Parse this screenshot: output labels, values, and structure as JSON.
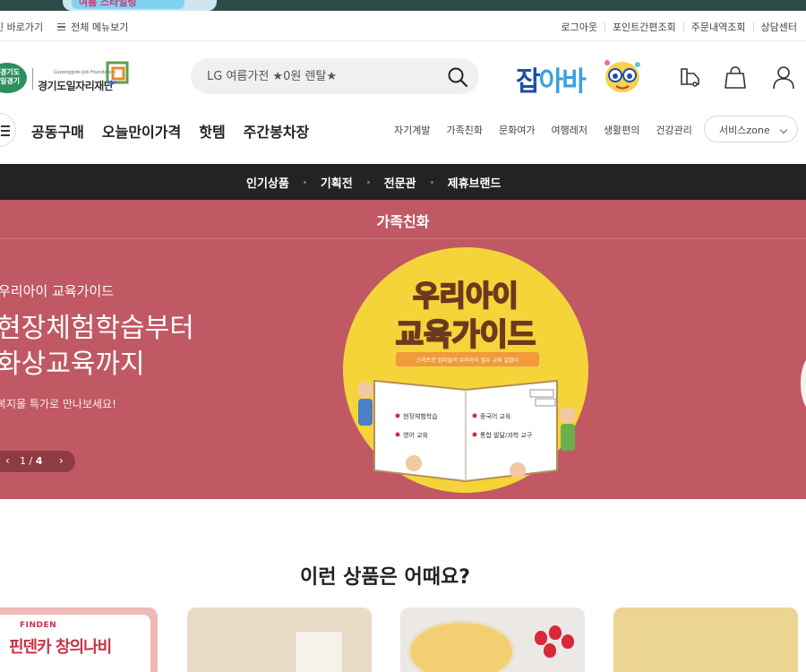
{
  "promo": {
    "text": "여름 스타일링"
  },
  "utility": {
    "left": [
      "인 바로가기",
      "전체 메뉴보기"
    ],
    "right": [
      "로그아웃",
      "포인트간편조회",
      "주문내역조회",
      "상담센터"
    ]
  },
  "logo": {
    "badge": "경기도 일경기",
    "foundation_en": "Gyeonggido Job Foundation",
    "foundation": "경기도일자리재단"
  },
  "search": {
    "placeholder": "LG 여름가전 ★0원 렌탈★"
  },
  "jobaba": {
    "part1": "잡",
    "part2": "아바"
  },
  "nav": {
    "main": [
      "공동구매",
      "오늘만이가격",
      "핫템",
      "주간봉차장"
    ],
    "sub": [
      "자기계발",
      "가족친화",
      "문화여가",
      "여행레저",
      "생활편의",
      "건강관리"
    ],
    "service_zone": "서비스zone"
  },
  "categories": [
    "인기상품",
    "기획전",
    "전문관",
    "제휴브랜드"
  ],
  "hero": {
    "heading": "가족친화",
    "kicker": "우리아이 교육가이드",
    "title_line1": "현장체험학습부터",
    "title_line2": "화상교육까지",
    "desc": "복지몰 특가로 만나보세요!",
    "pager_current": "1",
    "pager_sep": " / ",
    "pager_total": "4",
    "art": {
      "title1": "우리아이",
      "title2": "교육가이드",
      "tagline": "스마트한 엄마들의 우리아이 필수 교육 길잡이",
      "items": [
        "현장체험학습",
        "중국어 교육",
        "영어 교육",
        "통합 발달/과학 교구"
      ]
    }
  },
  "recommend": {
    "title": "이런 상품은 어때요?",
    "card1_brand": "FINDEN",
    "card1_name": "핀덴카 창의나비"
  },
  "colors": {
    "hero_bg": "#c05963",
    "category_bar": "#232323",
    "jobaba_blue": "#1f4ea8",
    "jobaba_light": "#3aa0e0"
  }
}
